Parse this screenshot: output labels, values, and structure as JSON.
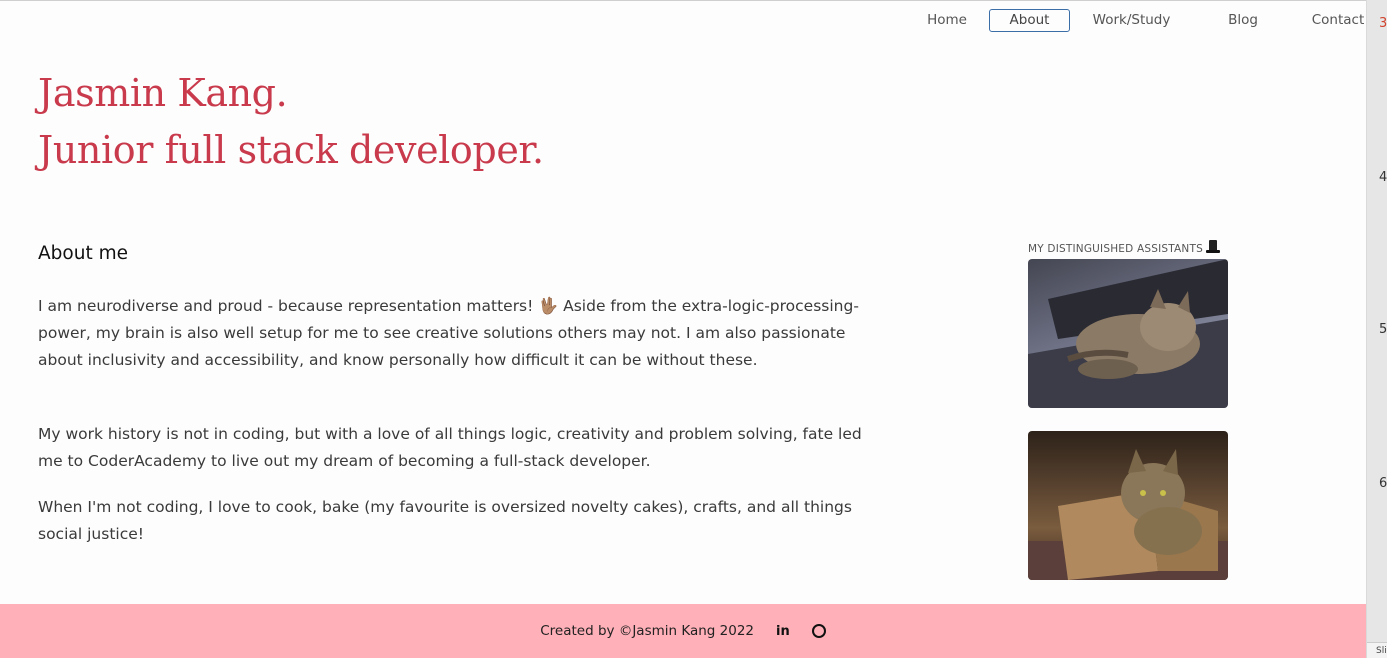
{
  "nav": {
    "items": [
      {
        "label": "Home"
      },
      {
        "label": "About"
      },
      {
        "label": "Work/Study"
      },
      {
        "label": "Blog"
      },
      {
        "label": "Contact"
      }
    ]
  },
  "hero": {
    "line1": "Jasmin Kang.",
    "line2": "Junior full stack developer."
  },
  "about": {
    "heading": "About me",
    "p1_a": "I am neurodiverse and proud - because representation matters! ",
    "p1_emoji": "🖖🏽",
    "p1_b": " Aside from the extra-logic-processing-power, my brain is also well setup for me to see creative solutions others may not. I am also passionate about inclusivity and accessibility, and know personally how difficult it can be without these.",
    "p2": "My work history is not in coding, but with a love of all things logic, creativity and problem solving, fate led me to CoderAcademy to live out my dream of becoming a full-stack developer.",
    "p3": "When I'm not coding, I love to cook, bake (my favourite is oversized novelty cakes), crafts, and all things social justice!"
  },
  "assistants": {
    "title": "MY DISTINGUISHED ASSISTANTS"
  },
  "footer": {
    "text": "Created by ©Jasmin Kang 2022",
    "linkedin": "in"
  },
  "sidebar": {
    "n3": "3",
    "n4": "4",
    "n5": "5",
    "n6": "6",
    "sl": "Sli"
  }
}
